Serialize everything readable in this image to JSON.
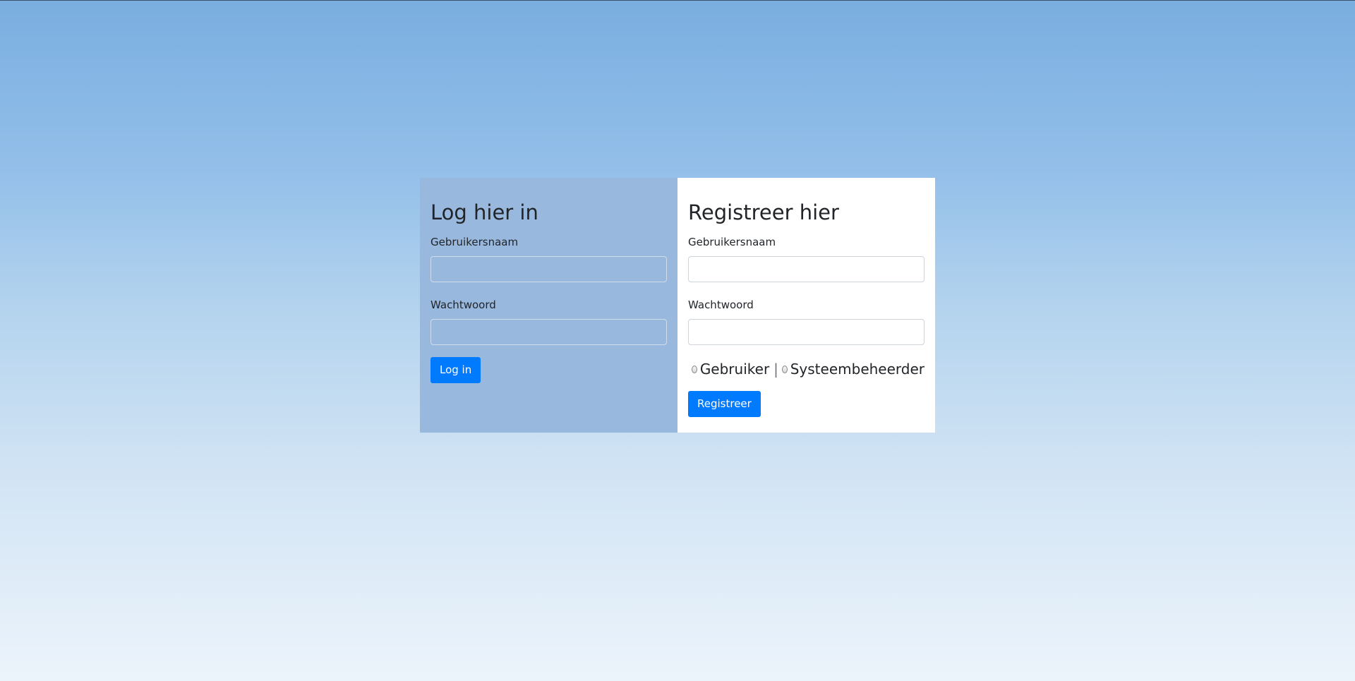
{
  "login": {
    "title": "Log hier in",
    "username_label": "Gebruikersnaam",
    "username_value": "",
    "password_label": "Wachtwoord",
    "password_value": "",
    "submit_label": "Log in"
  },
  "register": {
    "title": "Registreer hier",
    "username_label": "Gebruikersnaam",
    "username_value": "",
    "password_label": "Wachtwoord",
    "password_value": "",
    "role_options": [
      "Gebruiker",
      "Systeembeheerder"
    ],
    "role_separator": "|",
    "submit_label": "Registreer"
  },
  "colors": {
    "login_panel_bg": "#99b8de",
    "register_panel_bg": "#ffffff",
    "button_bg": "#007bff"
  }
}
